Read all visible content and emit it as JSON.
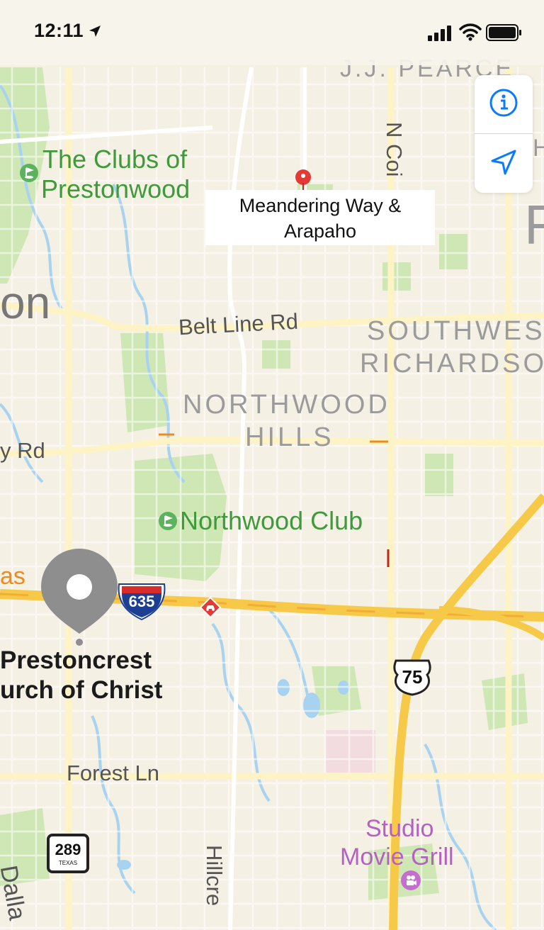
{
  "status_bar": {
    "time": "12:11",
    "icons": [
      "location-arrow-icon",
      "signal-icon",
      "wifi-icon",
      "battery-icon"
    ]
  },
  "map_controls": {
    "info_icon": "info-icon",
    "location_icon": "location-arrow-icon",
    "accent": "#0a7aff"
  },
  "pin_callout": {
    "line1": "Meandering Way &",
    "line2": "Arapaho"
  },
  "labels": {
    "jj_pearce": "J.J. PEARCE",
    "clubs_line1": "The Clubs of",
    "clubs_line2": "Prestonwood",
    "n_coit": "N Coi",
    "f_fragment": "F",
    "h_fragment": "H",
    "on_fragment": "on",
    "belt_line": "Belt Line Rd",
    "southwest_line1": "SOUTHWES",
    "southwest_line2": "RICHARDSO",
    "northwood_line1": "NORTHWOOD",
    "northwood_line2": "HILLS",
    "y_rd": "y Rd",
    "northwood_club": "Northwood Club",
    "as_fragment": "as",
    "i635": "635",
    "prestoncrest_line1": "Prestoncrest",
    "prestoncrest_line2": "urch of Christ",
    "us75": "75",
    "forest_ln": "Forest Ln",
    "studio_line1": "Studio",
    "studio_line2": "Movie Grill",
    "tx289": "289",
    "tx289_state": "TEXAS",
    "hillcrest": "Hillcre",
    "dallas_fragment": "Dalla"
  },
  "colors": {
    "land": "#f5f0e4",
    "park": "#cfe6b5",
    "water": "#a8d3f0",
    "highway": "#f7c948",
    "road": "#ffffff",
    "pin_red": "#e53935",
    "park_label": "#3f9a3a",
    "poi_label": "#b561c1"
  }
}
